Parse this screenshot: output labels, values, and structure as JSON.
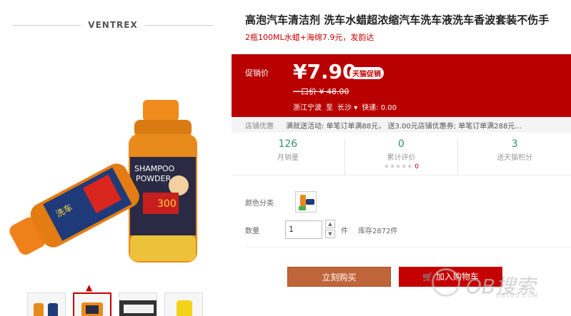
{
  "brand": "VENTREX",
  "product": {
    "title": "高泡汽车清洁剂 洗车水蜡超浓缩汽车洗车液洗车香波套装不伤手",
    "subtitle": "2瓶100ML水蜡+海绵7.9元，发韵达"
  },
  "price": {
    "label": "促销价",
    "value": "¥7.90",
    "badge": "天猫促销",
    "original": "一口价 ¥ 48.00",
    "ship_from": "浙江宁波",
    "ship_to_word": "至",
    "ship_to": "长沙",
    "ship_fee": "快递: 0.00"
  },
  "discount": {
    "label": "店铺优惠",
    "text": "满就送活动: 单笔订单满88元， 送3.00元店铺优惠券; 单笔订单满288元..."
  },
  "stats": [
    {
      "num": "126",
      "label": "月销量"
    },
    {
      "num": "0",
      "label": "累计评价",
      "stars": "★★★★★",
      "score": "0"
    },
    {
      "num": "3",
      "label": "送天猫积分"
    }
  ],
  "options": {
    "color_label": "颜色分类",
    "qty_label": "数量",
    "qty_value": "1",
    "unit": "件",
    "stock": "库存2872件"
  },
  "buttons": {
    "buy": "立刻购买",
    "cart": "加入购物车"
  },
  "watermark": {
    "text": "OB搜索",
    "sub": "OBSOU.COM"
  },
  "colors": {
    "accent": "#c40000",
    "buy": "#c0653a",
    "stat": "#3a8a6a"
  }
}
